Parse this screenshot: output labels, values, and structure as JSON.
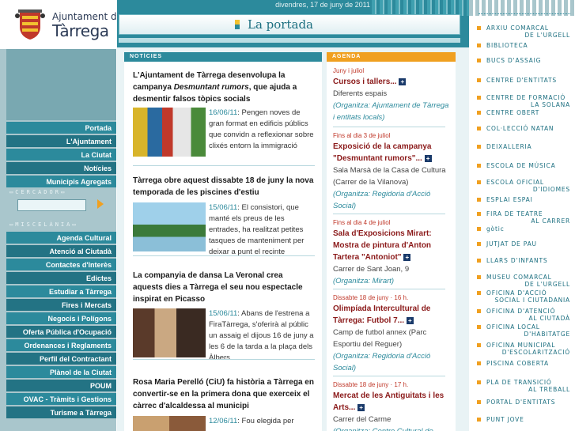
{
  "header": {
    "date": "divendres, 17 de juny de 2011",
    "section_title": "La portada"
  },
  "logo": {
    "line1": "Ajuntament de",
    "line2": "Tàrrega"
  },
  "nav_main": [
    "Portada",
    "L'Ajuntament",
    "La Ciutat",
    "Notícies",
    "Municipis Agregats"
  ],
  "search": {
    "label": "CERCADOR",
    "placeholder": ""
  },
  "misc_label": "MISCELÀNIA",
  "nav_misc": [
    "Agenda Cultural",
    "Atenció al Ciutadà",
    "Contactes d'Interès",
    "Edictes",
    "Estudiar a Tàrrega",
    "Fires i Mercats",
    "Negocis i Polígons",
    "Oferta Pública d'Ocupació",
    "Ordenances i Reglaments",
    "Perfil del Contractant",
    "Plànol de la Ciutat",
    "POUM",
    "OVAC - Tràmits i Gestions",
    "Turisme a Tàrrega"
  ],
  "news_header": "NOTÍCIES",
  "news": [
    {
      "title_pre": "L'Ajuntament de Tàrrega desenvolupa la campanya ",
      "title_em": "Desmuntant rumors",
      "title_post": ", que ajuda a desmentir falsos tòpics socials",
      "date": "16/06/11",
      "body": ": Pengen noves de gran format en edificis públics que convidn a reflexionar sobre clixés entorn la immigració"
    },
    {
      "title_pre": "Tàrrega obre aquest dissabte 18 de juny la nova temporada de les piscines d'estiu",
      "title_em": "",
      "title_post": "",
      "date": "15/06/11",
      "body": ": El consistori, que manté els preus de les entrades, ha realitzat petites tasques de manteniment per deixar a punt el recinte"
    },
    {
      "title_pre": "La companyia de dansa La Veronal crea aquests dies a Tàrrega el seu nou espectacle inspirat en Picasso",
      "title_em": "",
      "title_post": "",
      "date": "15/06/11",
      "body": ": Abans de l'estrena a FiraTàrrega, s'oferirà al públic un assaig el dijous 16 de juny a les 6 de la tarda a la plaça dels Àlbers"
    },
    {
      "title_pre": "Rosa Maria Perelló (CiU) fa història a Tàrrega en convertir-se en la primera dona que exerceix el càrrec d'alcaldessa al municipi",
      "title_em": "",
      "title_post": "",
      "date": "12/06/11",
      "body": ": Fou elegida per"
    }
  ],
  "agenda_header": "AGENDA",
  "agenda": [
    {
      "when": "Juny i juliol",
      "title": "Cursos i tallers...",
      "place": "Diferents espais",
      "org": "(Organitza: Ajuntament de Tàrrega i entitats locals)"
    },
    {
      "when": "Fins al dia 3 de juliol",
      "title": "Exposició de la campanya \"Desmuntant rumors\"...",
      "place": "Sala Marsà de la Casa de Cultura (Carrer de la Vilanova)",
      "org": "(Organitza: Regidoria d'Acció Social)"
    },
    {
      "when": "Fins al dia 4 de juliol",
      "title": "Sala d'Exposicions Mirart: Mostra de pintura d'Anton Tartera \"Antoniot\"",
      "place": "Carrer de Sant Joan, 9",
      "org": "(Organitza: Mirart)"
    },
    {
      "when": "Dissabte 18 de juny · 16 h.",
      "title": "Olimpíada Intercultural de Tàrrega: Futbol 7...",
      "place": "Camp de futbol annex (Parc Esportiu del Reguer)",
      "org": "(Organitza: Regidoria d'Acció Social)"
    },
    {
      "when": "Dissabte 18 de juny · 17 h.",
      "title": "Mercat de les Antiguitats i les Arts...",
      "place": "Carrer del Carme",
      "org": "(Organitza: Centre Cultural de"
    }
  ],
  "right_links": [
    {
      "a": "ARXIU COMARCAL",
      "b": "DE L'URGELL"
    },
    {
      "a": "BIBLIOTECA",
      "b": ""
    },
    {
      "a": "BUCS D'ASSAIG",
      "b": ""
    },
    {
      "a": "CENTRE D'ENTITATS",
      "b": ""
    },
    {
      "a": "CENTRE DE FORMACIÓ",
      "b": "LA SOLANA"
    },
    {
      "a": "CENTRE OBERT",
      "b": ""
    },
    {
      "a": "COL·LECCIÓ NATAN",
      "b": ""
    },
    {
      "a": "DEIXALLERIA",
      "b": ""
    },
    {
      "a": "ESCOLA DE MÚSICA",
      "b": ""
    },
    {
      "a": "ESCOLA OFICIAL",
      "b": "D'IDIOMES"
    },
    {
      "a": "ESPLAI ESPAI",
      "b": ""
    },
    {
      "a": "FIRA DE TEATRE",
      "b": "AL CARRER"
    },
    {
      "a": "gòtic",
      "b": ""
    },
    {
      "a": "JUTJAT DE PAU",
      "b": ""
    },
    {
      "a": "LLARS D'INFANTS",
      "b": ""
    },
    {
      "a": "MUSEU COMARCAL",
      "b": "DE L'URGELL"
    },
    {
      "a": "OFICINA D'ACCIÓ",
      "b": "SOCIAL I CIUTADANIA"
    },
    {
      "a": "OFICINA D'ATENCIÓ",
      "b": "AL CIUTADÀ"
    },
    {
      "a": "OFICINA LOCAL",
      "b": "D'HABITATGE"
    },
    {
      "a": "OFICINA MUNICIPAL",
      "b": "D'ESCOLARITZACIÓ"
    },
    {
      "a": "PISCINA COBERTA",
      "b": ""
    },
    {
      "a": "PLA DE TRANSICIÓ",
      "b": "AL TREBALL"
    },
    {
      "a": "PORTAL D'ENTITATS",
      "b": ""
    },
    {
      "a": "PUNT JOVE",
      "b": ""
    }
  ],
  "colors": {
    "teal": "#2c8a9c",
    "orange": "#f0a020",
    "sidebar": "#a9c6cc",
    "title_red": "#8b1a1a"
  }
}
